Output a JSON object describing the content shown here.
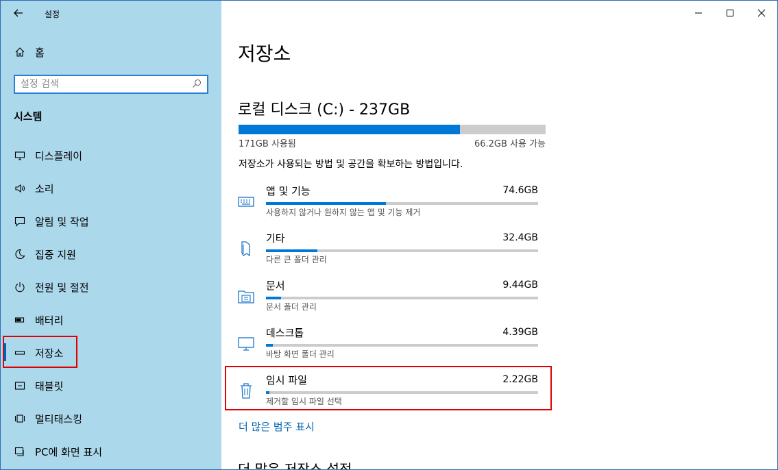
{
  "window": {
    "title": "설정"
  },
  "sidebar": {
    "home_label": "홈",
    "search_placeholder": "설정 검색",
    "section_title": "시스템",
    "items": [
      {
        "label": "디스플레이",
        "icon": "monitor-icon"
      },
      {
        "label": "소리",
        "icon": "speaker-icon"
      },
      {
        "label": "알림 및 작업",
        "icon": "notification-icon"
      },
      {
        "label": "집중 지원",
        "icon": "moon-icon"
      },
      {
        "label": "전원 및 절전",
        "icon": "power-icon"
      },
      {
        "label": "배터리",
        "icon": "battery-icon"
      },
      {
        "label": "저장소",
        "icon": "storage-icon",
        "selected": true
      },
      {
        "label": "태블릿",
        "icon": "tablet-icon"
      },
      {
        "label": "멀티태스킹",
        "icon": "multitasking-icon"
      },
      {
        "label": "PC에 화면 표시",
        "icon": "project-icon"
      }
    ]
  },
  "main": {
    "page_title": "저장소",
    "disk": {
      "title": "로컬 디스크 (C:) - 237GB",
      "used_label": "171GB 사용됨",
      "free_label": "66.2GB 사용 가능",
      "used_fraction": 0.72
    },
    "description": "저장소가 사용되는 방법 및 공간을 확보하는 방법입니다.",
    "categories": [
      {
        "name": "앱 및 기능",
        "size": "74.6GB",
        "sub": "사용하지 않거나 원하지 않는 앱 및 기능 제거",
        "fraction": 0.44,
        "icon": "apps-icon"
      },
      {
        "name": "기타",
        "size": "32.4GB",
        "sub": "다른 큰 폴더 관리",
        "fraction": 0.19,
        "icon": "other-icon"
      },
      {
        "name": "문서",
        "size": "9.44GB",
        "sub": "문서 폴더 관리",
        "fraction": 0.055,
        "icon": "documents-icon"
      },
      {
        "name": "데스크톱",
        "size": "4.39GB",
        "sub": "바탕 화면 폴더 관리",
        "fraction": 0.025,
        "icon": "desktop-icon"
      },
      {
        "name": "임시 파일",
        "size": "2.22GB",
        "sub": "제거할 임시 파일 선택",
        "fraction": 0.013,
        "icon": "trash-icon"
      }
    ],
    "more_link": "더 많은 범주 표시",
    "more_settings": "더 많은 저장소 설정"
  },
  "colors": {
    "sidebar_bg": "#acd8ec",
    "accent": "#0078d7",
    "highlight_box": "#e00000"
  }
}
